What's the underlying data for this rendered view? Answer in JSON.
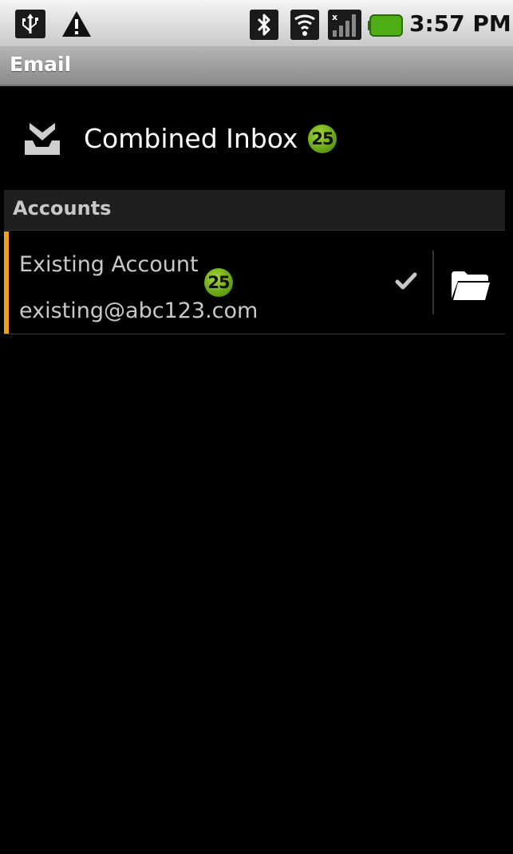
{
  "status_bar": {
    "time": "3:57 PM",
    "left_icons": [
      "usb-icon",
      "warning-icon"
    ],
    "right_icons": [
      "bluetooth-icon",
      "wifi-icon",
      "signal-icon",
      "battery-icon"
    ],
    "battery_color": "#4fae16"
  },
  "app": {
    "title": "Email"
  },
  "combined_inbox": {
    "label": "Combined Inbox",
    "unread_count": "25",
    "icon": "inbox-download-icon"
  },
  "accounts": {
    "header": "Accounts",
    "items": [
      {
        "name": "Existing Account",
        "email": "existing@abc123.com",
        "unread_count": "25",
        "checked": true,
        "accent_color": "#f0a020",
        "folder_icon": "folder-icon"
      }
    ]
  },
  "colors": {
    "badge": "#7cc11f",
    "background": "#000000",
    "accent": "#f0a020"
  }
}
